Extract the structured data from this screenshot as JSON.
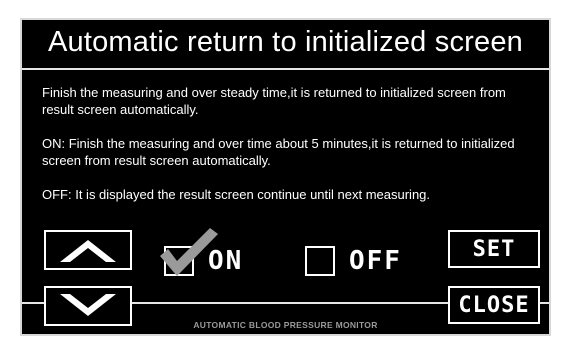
{
  "dialog": {
    "title": "Automatic return to initialized screen",
    "paragraphs": [
      "Finish the measuring and over steady time,it is returned to initialized screen from result screen automatically.",
      "ON: Finish the measuring and over time about 5 minutes,it is returned to initialized screen from result screen automatically.",
      "OFF: It is displayed the result screen continue until next measuring."
    ]
  },
  "controls": {
    "on_label": "ON",
    "off_label": "OFF",
    "on_checked": true,
    "off_checked": false,
    "set_label": "SET",
    "close_label": "CLOSE"
  },
  "footer": {
    "text": "AUTOMATIC BLOOD PRESSURE MONITOR"
  },
  "icons": {
    "up": "chevron-up-icon",
    "down": "chevron-down-icon",
    "check": "checkmark-icon"
  },
  "colors": {
    "background": "#000000",
    "foreground": "#ffffff",
    "check": "#9a9a9a",
    "footer": "#9a9a9a"
  }
}
